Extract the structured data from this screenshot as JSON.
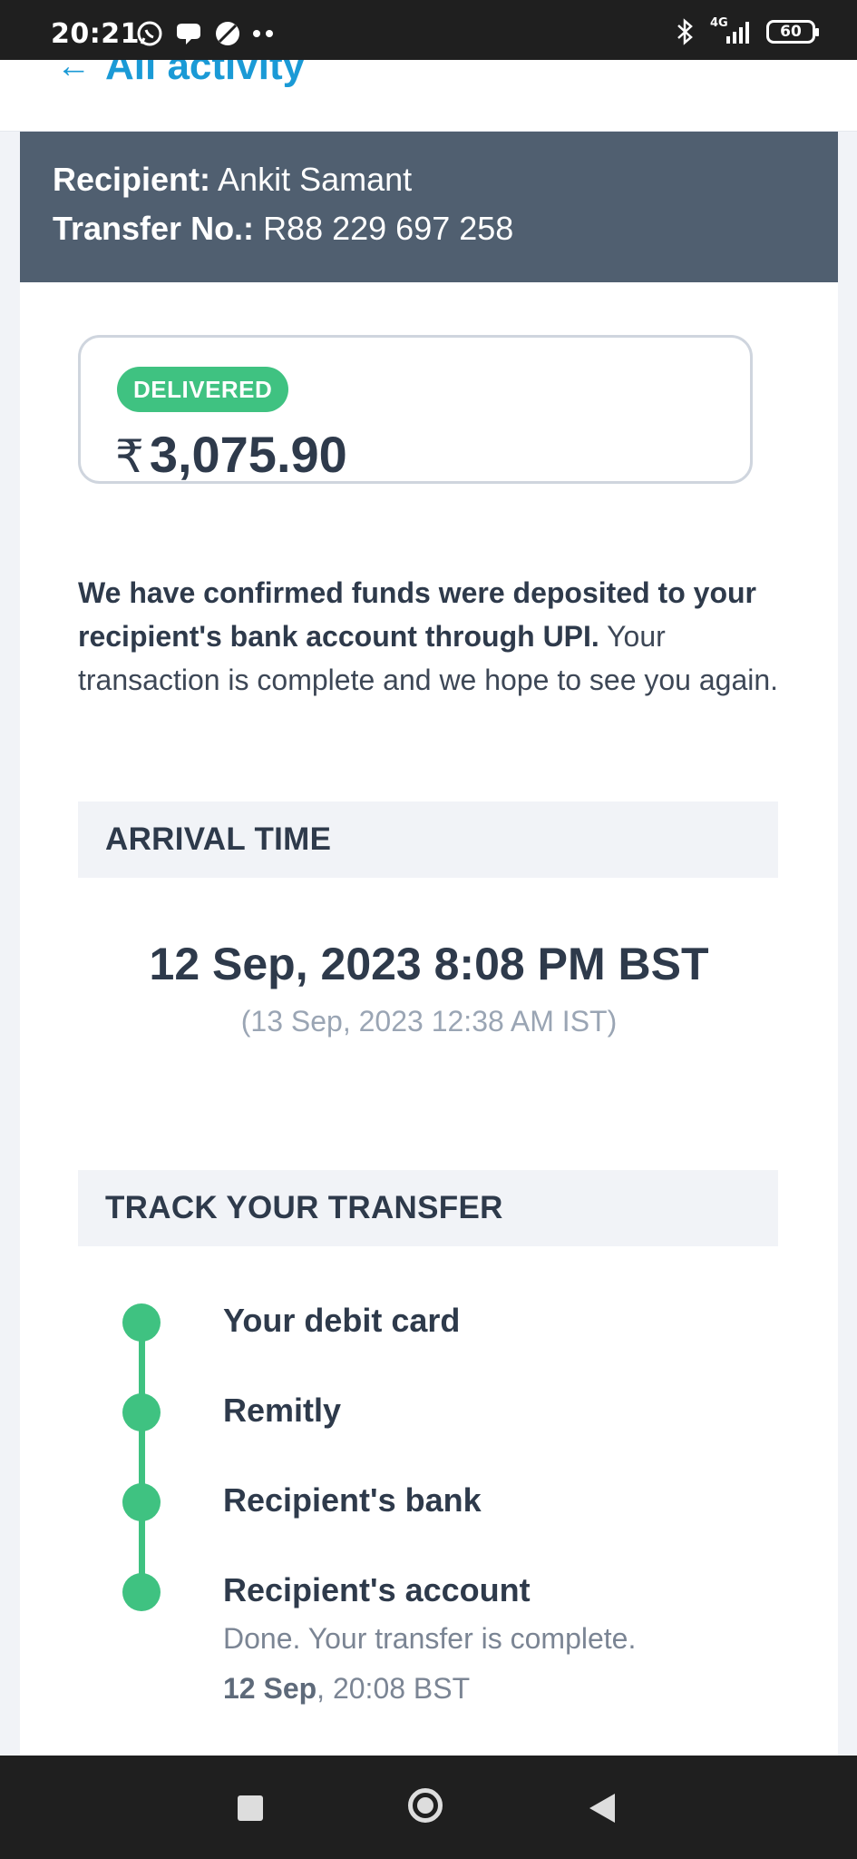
{
  "status_bar": {
    "time": "20:21",
    "network": "4G",
    "battery": "60"
  },
  "nav": {
    "back_label": "All activity"
  },
  "header": {
    "recipient_label": "Recipient:",
    "recipient_name": "Ankit Samant",
    "transfer_label": "Transfer No.:",
    "transfer_number": "R88 229 697 258"
  },
  "summary": {
    "status_badge": "DELIVERED",
    "currency_symbol": "₹",
    "amount": "3,075.90"
  },
  "message": {
    "bold": "We have confirmed funds were deposited to your recipient's bank account through UPI.",
    "normal": " Your transaction is complete and we hope to see you again."
  },
  "arrival": {
    "heading": "ARRIVAL TIME",
    "time_main": "12 Sep, 2023 8:08 PM BST",
    "time_local": "(13 Sep, 2023 12:38 AM IST)"
  },
  "tracking": {
    "heading": "TRACK YOUR TRANSFER",
    "steps": [
      {
        "label": "Your debit card"
      },
      {
        "label": "Remitly"
      },
      {
        "label": "Recipient's bank"
      },
      {
        "label": "Recipient's account",
        "detail": "Done. Your transfer is complete.",
        "date_bold": "12 Sep",
        "date_rest": ", 20:08 BST"
      }
    ]
  },
  "colors": {
    "accent_green": "#3fc281",
    "header_band": "#505f70",
    "link_blue": "#1a9ad6"
  }
}
